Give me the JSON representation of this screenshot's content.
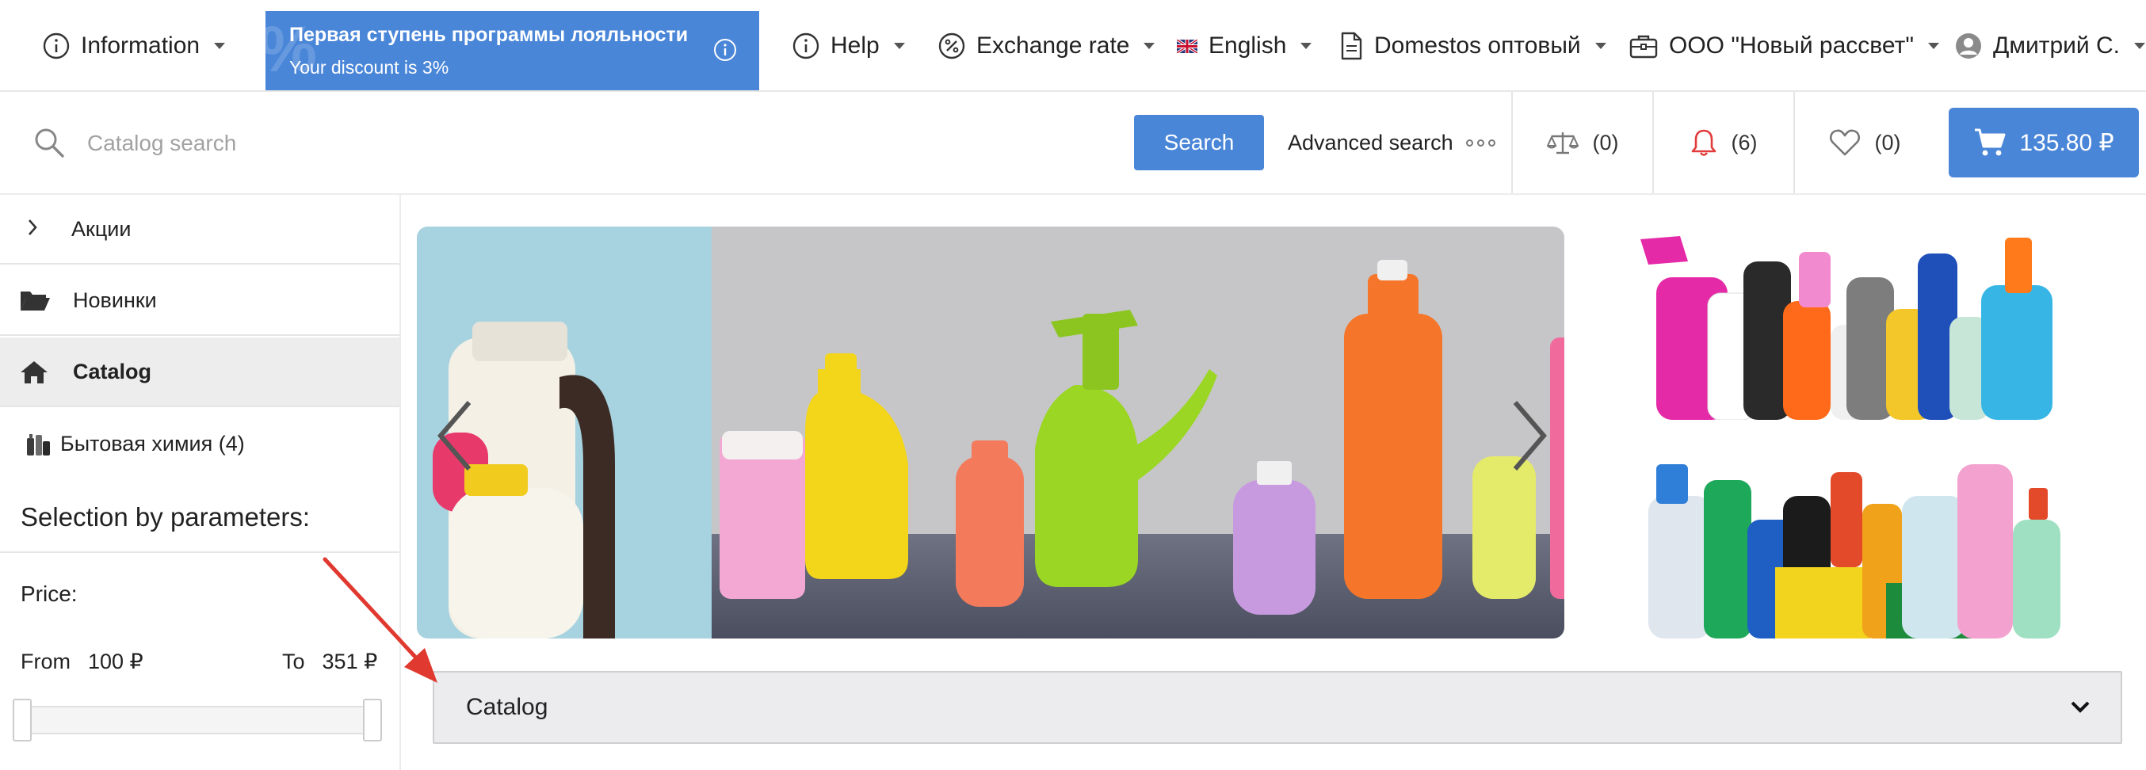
{
  "topbar": {
    "information": "Information",
    "loyalty_title": "Первая ступень программы лояльности",
    "loyalty_sub": "Your discount is 3%",
    "loyalty_bg_glyph": "%",
    "help": "Help",
    "exchange": "Exchange rate",
    "language": "English",
    "price_list": "Domestos оптовый",
    "company": "ООО \"Новый рассвет\"",
    "user": "Дмитрий С."
  },
  "search": {
    "placeholder": "Catalog search",
    "button": "Search",
    "advanced": "Advanced search"
  },
  "counters": {
    "compare": "(0)",
    "notifications": "(6)",
    "favorites": "(0)"
  },
  "cart": {
    "total": "135.80 ₽"
  },
  "sidebar": {
    "items": [
      {
        "label": "Акции",
        "icon": "chevron-right-icon"
      },
      {
        "label": "Новинки",
        "icon": "folder-open-icon"
      },
      {
        "label": "Catalog",
        "icon": "home-icon"
      },
      {
        "label": "Бытовая химия (4)",
        "icon": "category-thumbnail"
      }
    ],
    "selection_title": "Selection by parameters:",
    "price_label": "Price:",
    "from_label": "From",
    "from_value": "100 ₽",
    "to_label": "To",
    "to_value": "351 ₽"
  },
  "catalog_accordion": {
    "title": "Catalog"
  },
  "colors": {
    "accent": "#4a86d8",
    "notification": "#e23b3b",
    "annotation_arrow": "#e0392f"
  }
}
